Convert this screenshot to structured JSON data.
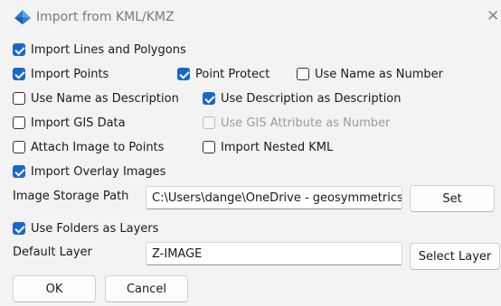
{
  "window": {
    "title": "Import from KML/KMZ",
    "accent_color": "#1768c9"
  },
  "options": {
    "import_lines_polygons": {
      "label": "Import Lines and Polygons",
      "checked": true
    },
    "import_points": {
      "label": "Import Points",
      "checked": true
    },
    "point_protect": {
      "label": "Point Protect",
      "checked": true
    },
    "use_name_as_number": {
      "label": "Use Name as Number",
      "checked": false
    },
    "use_name_as_description": {
      "label": "Use Name as Description",
      "checked": false
    },
    "use_description_as_description": {
      "label": "Use Description as Description",
      "checked": true
    },
    "import_gis_data": {
      "label": "Import GIS Data",
      "checked": false
    },
    "use_gis_attribute_as_number": {
      "label": "Use GIS Attribute as Number",
      "checked": false,
      "disabled": true
    },
    "attach_image_to_points": {
      "label": "Attach Image to Points",
      "checked": false
    },
    "import_nested_kml": {
      "label": "Import Nested KML",
      "checked": false
    },
    "import_overlay_images": {
      "label": "Import Overlay Images",
      "checked": true
    },
    "use_folders_as_layers": {
      "label": "Use Folders as Layers",
      "checked": true
    }
  },
  "image_storage": {
    "label": "Image Storage Path",
    "value": "C:\\Users\\dange\\OneDrive - geosymmetrics",
    "button": "Set"
  },
  "default_layer": {
    "label": "Default Layer",
    "value": "Z-IMAGE",
    "button": "Select Layer"
  },
  "footer": {
    "ok": "OK",
    "cancel": "Cancel"
  }
}
